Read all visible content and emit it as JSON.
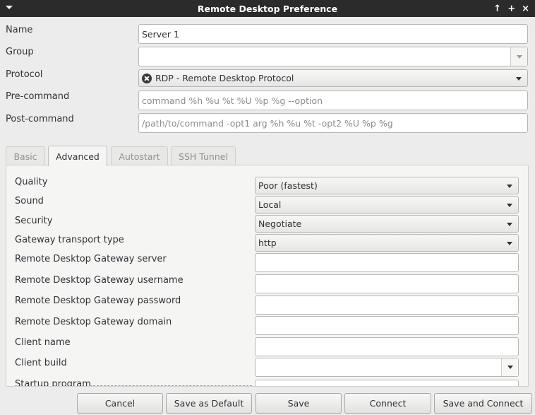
{
  "window": {
    "title": "Remote Desktop Preference",
    "btn_min": "↑",
    "btn_max": "+",
    "btn_close": "×"
  },
  "form": {
    "name_label": "Name",
    "name_value": "Server 1",
    "group_label": "Group",
    "group_value": "",
    "protocol_label": "Protocol",
    "protocol_value": "RDP - Remote Desktop Protocol",
    "precommand_label": "Pre-command",
    "precommand_placeholder": "command %h %u %t %U %p %g --option",
    "postcommand_label": "Post-command",
    "postcommand_placeholder": "/path/to/command -opt1 arg %h %u %t -opt2 %U %p %g"
  },
  "tabs": [
    {
      "label": "Basic",
      "active": false
    },
    {
      "label": "Advanced",
      "active": true
    },
    {
      "label": "Autostart",
      "active": false
    },
    {
      "label": "SSH Tunnel",
      "active": false
    }
  ],
  "advanced": {
    "quality_label": "Quality",
    "quality_value": "Poor (fastest)",
    "sound_label": "Sound",
    "sound_value": "Local",
    "security_label": "Security",
    "security_value": "Negotiate",
    "gateway_transport_label": "Gateway transport type",
    "gateway_transport_value": "http",
    "gateway_server_label": "Remote Desktop Gateway server",
    "gateway_username_label": "Remote Desktop Gateway username",
    "gateway_password_label": "Remote Desktop Gateway password",
    "gateway_domain_label": "Remote Desktop Gateway domain",
    "client_name_label": "Client name",
    "client_build_label": "Client build",
    "startup_program_label": "Startup program"
  },
  "buttons": {
    "cancel": "Cancel",
    "save_default": "Save as Default",
    "save": "Save",
    "connect": "Connect",
    "save_connect": "Save and Connect"
  }
}
